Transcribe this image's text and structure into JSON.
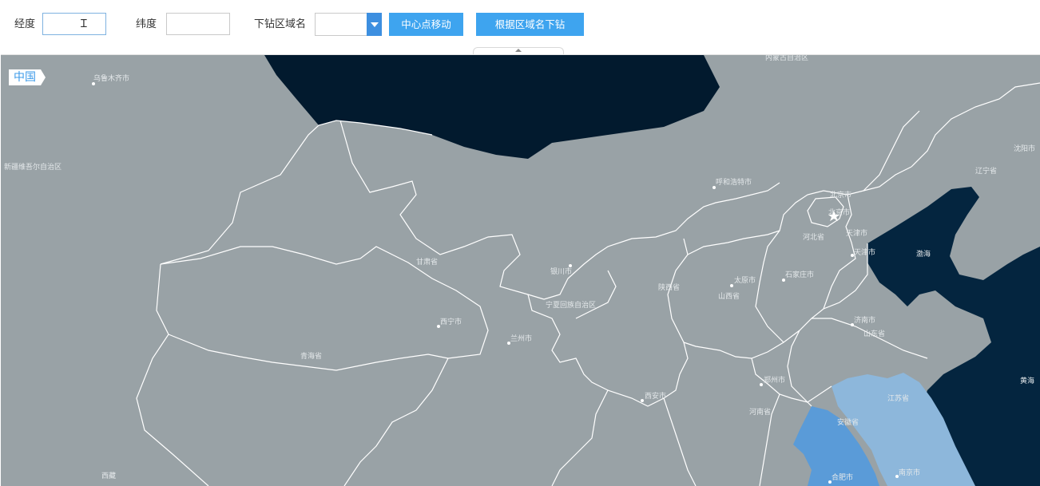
{
  "toolbar": {
    "longitude_label": "经度",
    "longitude_value": "",
    "latitude_label": "纬度",
    "latitude_value": "",
    "drill_label": "下钻区域名",
    "drill_selected": "",
    "center_move_button": "中心点移动",
    "drill_by_name_button": "根据区域名下钻"
  },
  "map": {
    "breadcrumb": "中国",
    "colors": {
      "land": "#99a2a6",
      "sea": "#021a2e",
      "sea_east": "#04253f",
      "border": "#ffffff",
      "anhui": "#5a9bd8",
      "jiangsu": "#8db7db"
    },
    "labels": [
      "乌鲁木齐市",
      "新疆维吾尔自治区",
      "内蒙古自治区",
      "呼和浩特市",
      "北京市",
      "北京市",
      "天津市",
      "天津市",
      "河北省",
      "石家庄市",
      "辽宁省",
      "沈阳市",
      "渤海",
      "黄海",
      "甘肃省",
      "银川市",
      "宁夏回族自治区",
      "西宁市",
      "兰州市",
      "青海省",
      "陕西省",
      "太原市",
      "山西省",
      "济南市",
      "山东省",
      "郑州市",
      "河南省",
      "西安市",
      "江苏省",
      "安徽省",
      "合肥市",
      "南京市",
      "西藏"
    ]
  }
}
